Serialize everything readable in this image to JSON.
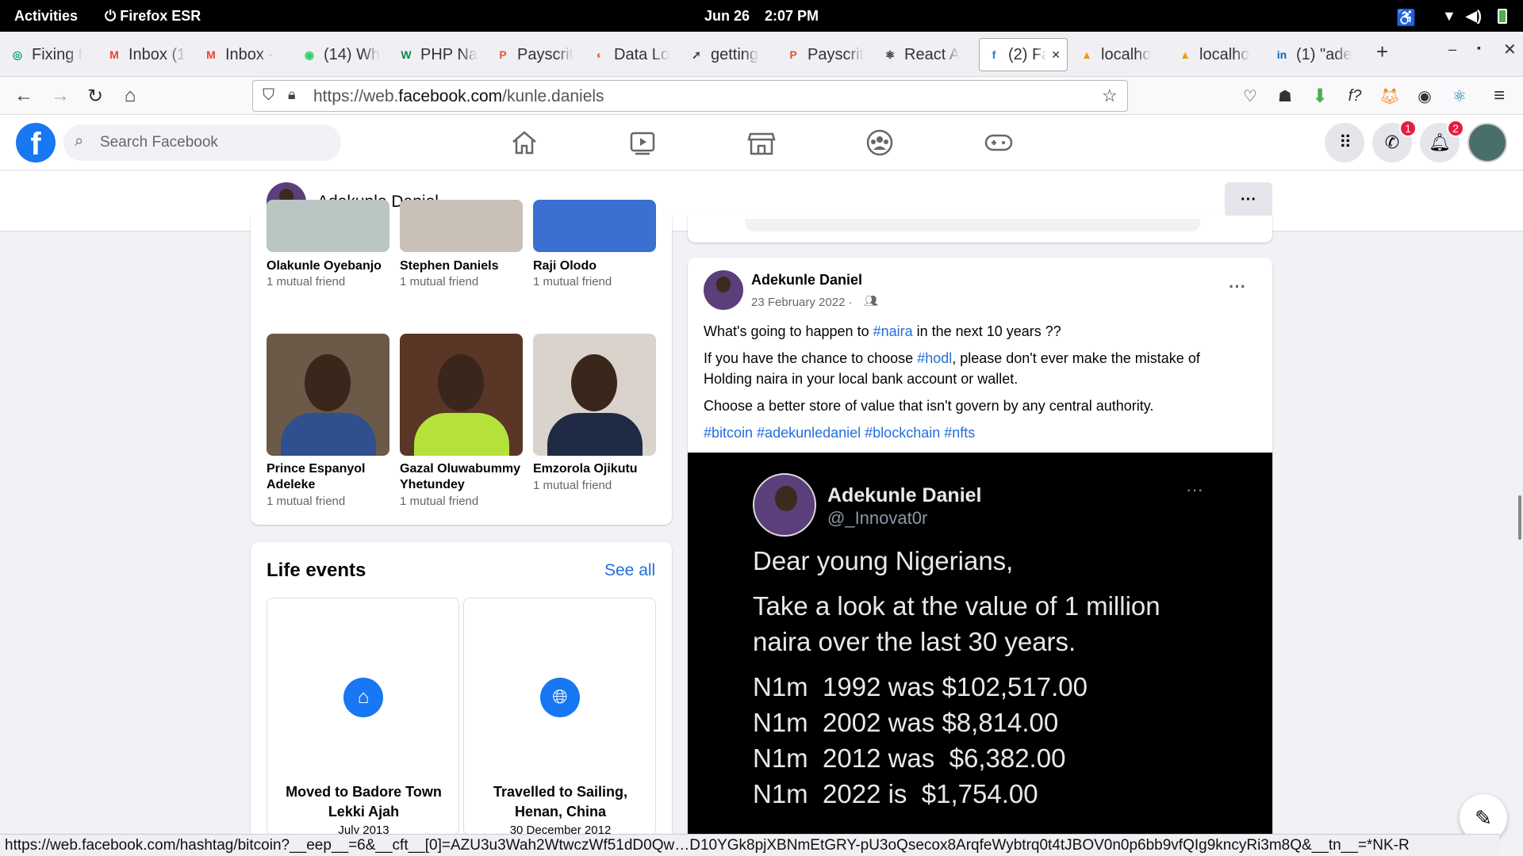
{
  "system": {
    "activities": "Activities",
    "app": "Firefox ESR",
    "date": "Jun 26",
    "time": "2:07 PM"
  },
  "tabs": [
    {
      "label": "Fixing t",
      "color": "#10a37f",
      "glyph": "◎"
    },
    {
      "label": "Inbox (1",
      "color": "#ea4335",
      "glyph": "M"
    },
    {
      "label": "Inbox -",
      "color": "#ea4335",
      "glyph": "M"
    },
    {
      "label": "(14) Wh",
      "color": "#25d366",
      "glyph": "◉"
    },
    {
      "label": "PHP Na",
      "color": "#0b8a3f",
      "glyph": "W"
    },
    {
      "label": "Payscrit",
      "color": "#e8552b",
      "glyph": "P"
    },
    {
      "label": "Data Lo",
      "color": "#f26b1d",
      "glyph": "◐"
    },
    {
      "label": "getting",
      "color": "#444",
      "glyph": "➚"
    },
    {
      "label": "Payscrit",
      "color": "#e8552b",
      "glyph": "P"
    },
    {
      "label": "React A",
      "color": "#20232a",
      "glyph": "⚛"
    },
    {
      "label": "(2) Fa",
      "color": "#1877f2",
      "glyph": "f"
    },
    {
      "label": "localho",
      "color": "#f39c12",
      "glyph": "▲"
    },
    {
      "label": "localho",
      "color": "#f39c12",
      "glyph": "▲"
    },
    {
      "label": "(1) \"ade",
      "color": "#0a66c2",
      "glyph": "in"
    }
  ],
  "browser": {
    "url_prefix": "https://web.",
    "url_domain": "facebook.com",
    "url_path": "/kunle.daniels"
  },
  "fb": {
    "search_placeholder": "Search Facebook",
    "messenger_badge": "1",
    "notif_badge": "2",
    "profile_name": "Adekunle Daniel"
  },
  "friends": [
    {
      "name": "Olakunle Oyebanjo",
      "sub": "1 mutual friend",
      "color": "#b9c6c4"
    },
    {
      "name": "Stephen Daniels",
      "sub": "1 mutual friend",
      "color": "#c9c0b8"
    },
    {
      "name": "Raji Olodo",
      "sub": "1 mutual friend",
      "color": "#3b6fd1"
    },
    {
      "name": "Prince Espanyol Adeleke",
      "sub": "1 mutual friend",
      "color": "#6a5a47"
    },
    {
      "name": "Gazal Oluwabummy Yhetundey",
      "sub": "1 mutual friend",
      "color": "#5a3626"
    },
    {
      "name": "Emzorola Ojikutu",
      "sub": "1 mutual friend",
      "color": "#d9d3cc"
    }
  ],
  "life_events": {
    "title": "Life events",
    "see_all": "See all",
    "items": [
      {
        "title": "Moved to Badore Town Lekki Ajah",
        "date": "July 2013",
        "icon": "home-icon"
      },
      {
        "title": "Travelled to Sailing, Henan, China",
        "date": "30 December 2012",
        "icon": "globe-icon"
      }
    ]
  },
  "post": {
    "author": "Adekunle Daniel",
    "date": "23 February 2022 ·",
    "line1_a": "What's going to happen to ",
    "line1_tag": "#naira",
    "line1_b": " in the next 10 years ??",
    "line2_a": "If you have the chance to choose ",
    "line2_tag": "#hodl",
    "line2_b": ", please don't ever make the mistake of",
    "line3": "Holding naira in your local bank account or wallet.",
    "line4": "Choose a better store of value that isn't govern by any central authority.",
    "tags": "#bitcoin #adekunledaniel #blockchain #nfts"
  },
  "tweet": {
    "name": "Adekunle Daniel",
    "handle": "@_Innovat0r",
    "l1": "Dear young Nigerians,",
    "l2": "Take a look at the value of 1 million",
    "l3": "naira over the last 30 years.",
    "r1": "N1m  1992 was $102,517.00",
    "r2": "N1m  2002 was $8,814.00",
    "r3": "N1m  2012 was  $6,382.00",
    "r4": "N1m  2022 is  $1,754.00"
  },
  "statusbar": "https://web.facebook.com/hashtag/bitcoin?__eep__=6&__cft__[0]=AZU3u3Wah2WtwczWf51dD0Qw…D10YGk8pjXBNmEtGRY-pU3oQsecox8ArqfeWybtrq0t4tJBOV0n0p6bb9vfQIg9kncyRi3m8Q&__tn__=*NK-R"
}
